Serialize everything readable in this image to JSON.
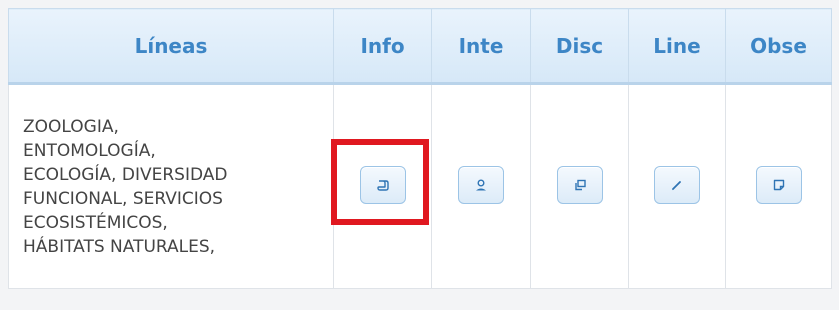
{
  "table": {
    "headers": {
      "lineas": "Líneas",
      "info": "Info",
      "inte": "Inte",
      "disc": "Disc",
      "line": "Line",
      "obse": "Obse"
    },
    "row": {
      "lineas_text": [
        "ZOOLOGIA,",
        "ENTOMOLOGÍA,",
        "ECOLOGÍA, DIVERSIDAD",
        "FUNCIONAL, SERVICIOS",
        "ECOSISTÉMICOS,",
        "HÁBITATS NATURALES,"
      ]
    },
    "action_icons": {
      "info": "scroll-icon",
      "inte": "person-icon",
      "disc": "copy-icon",
      "line": "pencil-icon",
      "obse": "note-icon"
    }
  },
  "colors": {
    "header_text": "#3d86c6",
    "header_bg": "#d6e8f8",
    "highlight_box": "#e01820",
    "icon": "#2f74b4"
  }
}
